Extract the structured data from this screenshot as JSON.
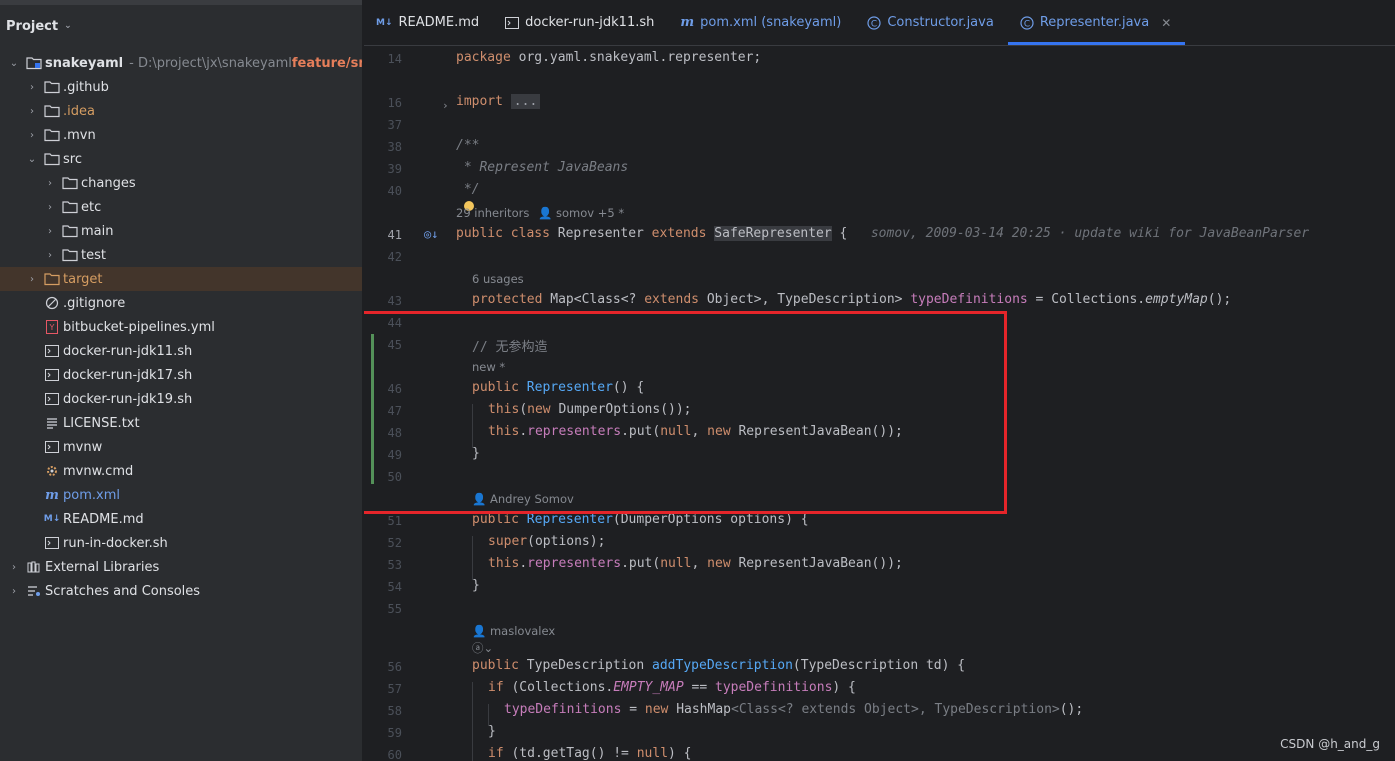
{
  "project": {
    "title": "Project",
    "tree": [
      {
        "name": "snakeyaml",
        "path": "- D:\\project\\jx\\snakeyaml",
        "branch": "feature/snake",
        "icon": "module-folder-icon",
        "arrow": "open",
        "depth": 0
      },
      {
        "name": ".github",
        "icon": "folder-icon",
        "arrow": "closed",
        "depth": 1
      },
      {
        "name": ".idea",
        "icon": "folder-icon",
        "arrow": "closed",
        "depth": 1,
        "color": "orange"
      },
      {
        "name": ".mvn",
        "icon": "folder-icon",
        "arrow": "closed",
        "depth": 1
      },
      {
        "name": "src",
        "icon": "folder-icon",
        "arrow": "open",
        "depth": 1
      },
      {
        "name": "changes",
        "icon": "folder-icon",
        "arrow": "closed",
        "depth": 2
      },
      {
        "name": "etc",
        "icon": "folder-icon",
        "arrow": "closed",
        "depth": 2
      },
      {
        "name": "main",
        "icon": "folder-icon",
        "arrow": "closed",
        "depth": 2
      },
      {
        "name": "test",
        "icon": "folder-icon",
        "arrow": "closed",
        "depth": 2
      },
      {
        "name": "target",
        "icon": "folder-orange-icon",
        "arrow": "closed",
        "depth": 1,
        "color": "orange",
        "selected": true
      },
      {
        "name": ".gitignore",
        "icon": "ignore-file-icon",
        "arrow": "none",
        "depth": 1
      },
      {
        "name": "bitbucket-pipelines.yml",
        "icon": "yaml-file-icon",
        "arrow": "none",
        "depth": 1
      },
      {
        "name": "docker-run-jdk11.sh",
        "icon": "shell-file-icon",
        "arrow": "none",
        "depth": 1
      },
      {
        "name": "docker-run-jdk17.sh",
        "icon": "shell-file-icon",
        "arrow": "none",
        "depth": 1
      },
      {
        "name": "docker-run-jdk19.sh",
        "icon": "shell-file-icon",
        "arrow": "none",
        "depth": 1
      },
      {
        "name": "LICENSE.txt",
        "icon": "text-file-icon",
        "arrow": "none",
        "depth": 1
      },
      {
        "name": "mvnw",
        "icon": "shell-file-icon",
        "arrow": "none",
        "depth": 1
      },
      {
        "name": "mvnw.cmd",
        "icon": "cmd-file-icon",
        "arrow": "none",
        "depth": 1
      },
      {
        "name": "pom.xml",
        "icon": "maven-file-icon",
        "arrow": "none",
        "depth": 1,
        "color": "blue"
      },
      {
        "name": "README.md",
        "icon": "markdown-file-icon",
        "arrow": "none",
        "depth": 1
      },
      {
        "name": "run-in-docker.sh",
        "icon": "shell-file-icon",
        "arrow": "none",
        "depth": 1
      },
      {
        "name": "External Libraries",
        "icon": "library-icon",
        "arrow": "closed",
        "depth": 0
      },
      {
        "name": "Scratches and Consoles",
        "icon": "scratches-icon",
        "arrow": "closed",
        "depth": 0
      }
    ]
  },
  "tabs": [
    {
      "label": "README.md",
      "icon": "markdown-icon"
    },
    {
      "label": "docker-run-jdk11.sh",
      "icon": "shell-icon"
    },
    {
      "label": "pom.xml (snakeyaml)",
      "icon": "maven-icon",
      "color": "blue"
    },
    {
      "label": "Constructor.java",
      "icon": "java-class-icon",
      "color": "blue"
    },
    {
      "label": "Representer.java",
      "icon": "java-class-icon",
      "color": "blue",
      "active": true
    }
  ],
  "editor": {
    "line_numbers": [
      "14",
      "16",
      "37",
      "38",
      "39",
      "40",
      "41",
      "42",
      "43",
      "44",
      "45",
      "46",
      "47",
      "48",
      "49",
      "50",
      "51",
      "52",
      "53",
      "54",
      "55",
      "56",
      "57",
      "58",
      "59",
      "60"
    ],
    "hints": {
      "inheritors": "29 inheritors",
      "authors": "somov +5 *",
      "usages": "6 usages",
      "new_marker": "new *",
      "author_somov": "Andrey Somov",
      "author_maslov": "maslovalex",
      "ai_hint": "ⓐ⌄"
    },
    "blame": "somov, 2009-03-14 20:25 · update wiki for JavaBeanParser",
    "comment_cn": "// 无参构造"
  },
  "watermark": "CSDN @h_and_g",
  "colors": {
    "accent": "#3574f0",
    "annotation": "#e5252a",
    "keyword": "#cf8e6d",
    "method": "#56a8f5",
    "field": "#c77dbb"
  }
}
